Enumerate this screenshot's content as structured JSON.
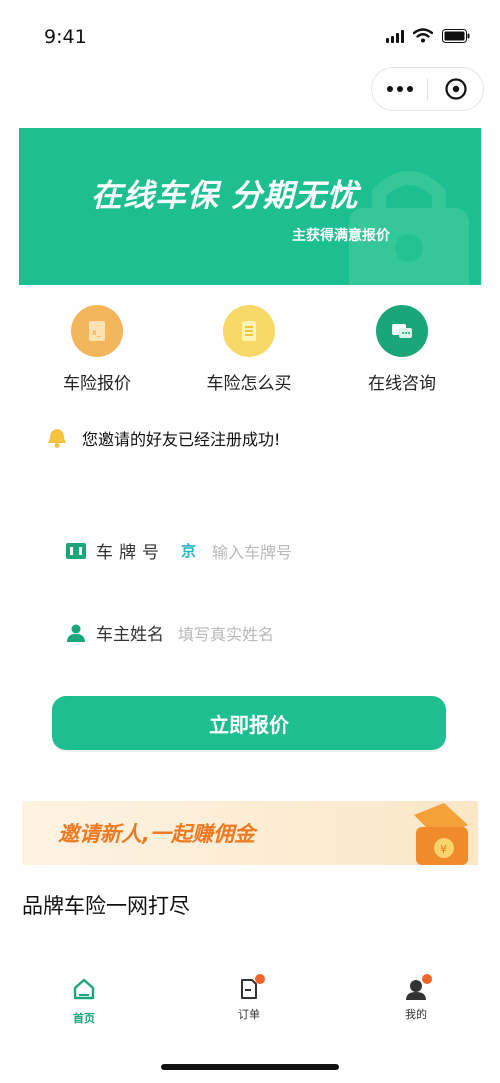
{
  "status_bar": {
    "time": "9:41"
  },
  "banner": {
    "title": "在线车保  分期无忧",
    "subtitle": "主获得满意报价"
  },
  "features": [
    {
      "label": "车险报价",
      "color": "#f4b65a"
    },
    {
      "label": "车险怎么买",
      "color": "#f8d968"
    },
    {
      "label": "在线咨询",
      "color": "#1aa679"
    }
  ],
  "notice": {
    "text": "您邀请的好友已经注册成功!"
  },
  "form": {
    "plate_label": "车牌号",
    "plate_prefix": "京",
    "plate_placeholder": "输入车牌号",
    "owner_label": "车主姓名",
    "owner_placeholder": "填写真实姓名"
  },
  "submit_label": "立即报价",
  "promo": {
    "text": "邀请新人,一起赚佣金"
  },
  "section_title": "品牌车险一网打尽",
  "tabs": [
    {
      "label": "首页",
      "active": true
    },
    {
      "label": "订单",
      "badge": true
    },
    {
      "label": "我的",
      "badge": true
    }
  ],
  "colors": {
    "primary": "#1dbf90",
    "badge": "#f0632a"
  }
}
